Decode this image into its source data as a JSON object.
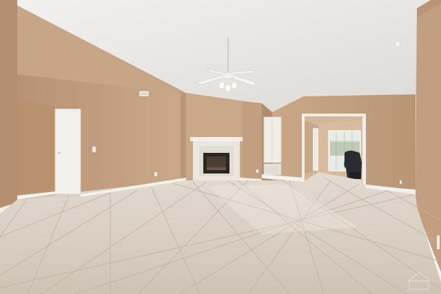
{
  "scene": {
    "subject": "empty-living-room",
    "elements": [
      "vaulted-ceiling",
      "ceiling-fan",
      "fireplace",
      "tile-floor",
      "interior-doors",
      "hallway-doorway",
      "sliding-glass-door",
      "armchair",
      "air-vent",
      "wall-outlets",
      "light-switch"
    ]
  },
  "colors": {
    "ceiling": "#efeeec",
    "wall": "#c8a687",
    "wall_shadow": "#b89576",
    "trim": "#f4f2ee",
    "floor_tile": "#d9cfc3",
    "floor_grout": "#bfb2a3",
    "fireplace_surround": "#ebe7e0",
    "firebox": "#2a2622"
  }
}
